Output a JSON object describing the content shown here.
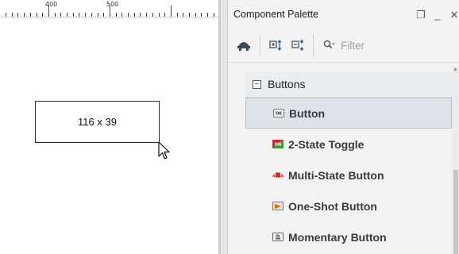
{
  "ruler": {
    "label_400": "400",
    "label_500": "500"
  },
  "canvas": {
    "component_size": "116 x 39"
  },
  "palette": {
    "title": "Component Palette",
    "controls": {
      "restore": "❐",
      "minimize": "_",
      "close": "✕"
    },
    "toolbar": {
      "icons": [
        "components-icon",
        "expand-all-icon",
        "collapse-all-icon"
      ],
      "filter_placeholder": "Filter"
    },
    "group": {
      "label": "Buttons",
      "collapse_symbol": "−"
    },
    "items": [
      {
        "label": "Button",
        "icon": "button-icon",
        "selected": true
      },
      {
        "label": "2-State Toggle",
        "icon": "toggle-icon",
        "selected": false
      },
      {
        "label": "Multi-State Button",
        "icon": "multistate-icon",
        "selected": false
      },
      {
        "label": "One-Shot Button",
        "icon": "oneshot-icon",
        "selected": false
      },
      {
        "label": "Momentary Button",
        "icon": "momentary-icon",
        "selected": false
      }
    ]
  }
}
